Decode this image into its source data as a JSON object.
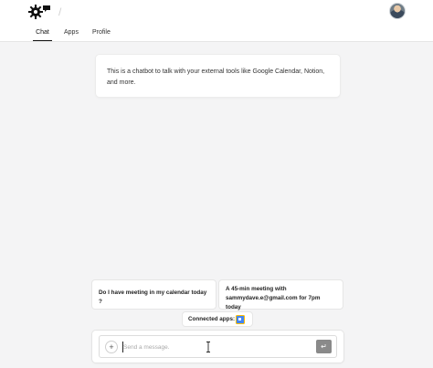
{
  "nav": {
    "tabs": [
      {
        "label": "Chat"
      },
      {
        "label": "Apps"
      },
      {
        "label": "Profile"
      }
    ],
    "active_tab": "Chat"
  },
  "intro": {
    "text": "This is a chatbot to talk with your external tools like Google Calendar, Notion, and more."
  },
  "suggestions": [
    {
      "text": "Do I have meeting in my calendar today ?"
    },
    {
      "text": "A 45-min meeting with sammydave.e@gmail.com for 7pm today"
    }
  ],
  "connected_apps": {
    "label": "Connected apps:",
    "apps": [
      "google-calendar-icon"
    ]
  },
  "composer": {
    "placeholder": "Send a message.",
    "value": "",
    "add_label": "+",
    "send_label": "↵"
  },
  "colors": {
    "background": "#f4f4f5",
    "card": "#ffffff",
    "send_button": "#8a8a8a"
  }
}
